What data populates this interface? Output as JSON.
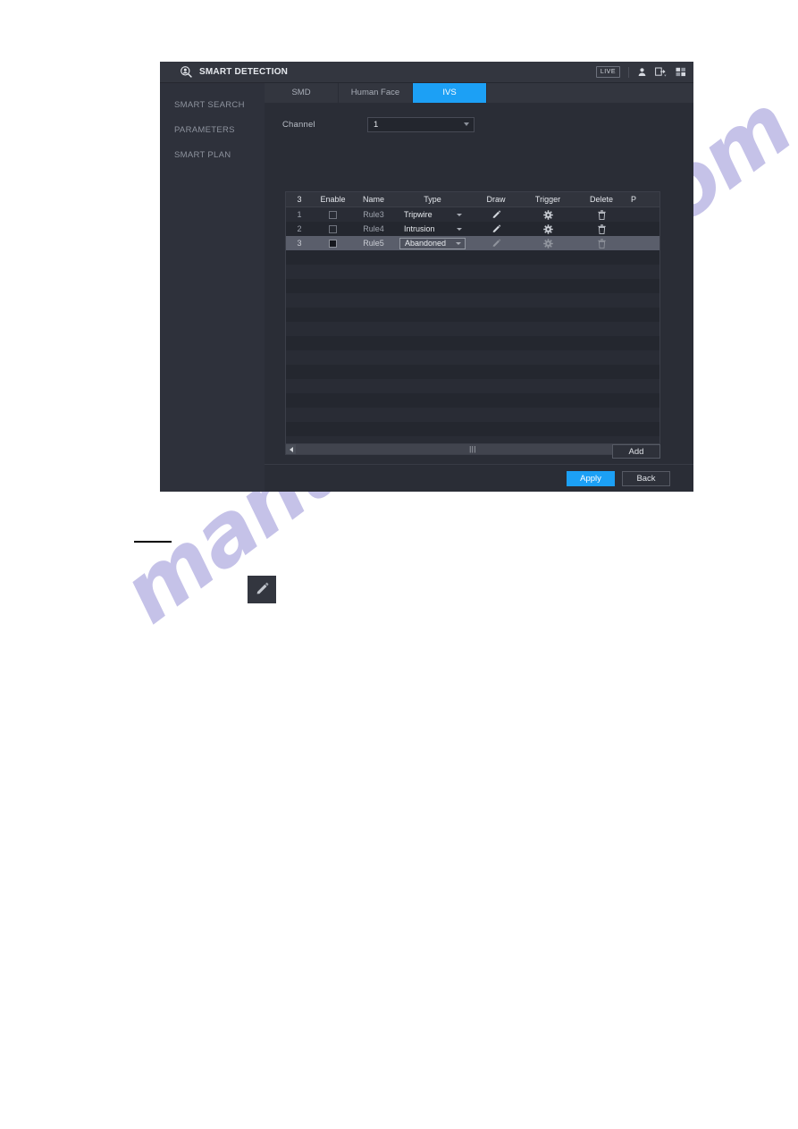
{
  "window": {
    "title": "SMART DETECTION",
    "title_icon": "smart-detection-icon",
    "live_badge": "LIVE",
    "icons": [
      "user-icon",
      "logout-icon",
      "chevron-down-icon",
      "layout-grid-icon"
    ]
  },
  "sidebar": {
    "items": [
      {
        "label": "SMART SEARCH"
      },
      {
        "label": "PARAMETERS"
      },
      {
        "label": "SMART PLAN"
      }
    ]
  },
  "tabs": [
    {
      "label": "SMD",
      "active": false
    },
    {
      "label": "Human Face",
      "active": false
    },
    {
      "label": "IVS",
      "active": true
    }
  ],
  "form": {
    "channel_label": "Channel",
    "channel_value": "1"
  },
  "table": {
    "headers": {
      "index": "3",
      "enable": "Enable",
      "name": "Name",
      "type": "Type",
      "draw": "Draw",
      "trigger": "Trigger",
      "delete": "Delete",
      "partial": "P"
    },
    "rows": [
      {
        "index": "1",
        "enabled": false,
        "name": "Rule3",
        "type": "Tripwire",
        "type_boxed": false,
        "selected": false,
        "draw_icon": "pencil-icon",
        "trigger_icon": "gear-icon",
        "delete_icon": "trash-icon"
      },
      {
        "index": "2",
        "enabled": false,
        "name": "Rule4",
        "type": "Intrusion",
        "type_boxed": false,
        "selected": false,
        "draw_icon": "pencil-icon",
        "trigger_icon": "gear-icon",
        "delete_icon": "trash-icon"
      },
      {
        "index": "3",
        "enabled": true,
        "name": "Rule5",
        "type": "Abandoned",
        "type_boxed": true,
        "selected": true,
        "draw_icon": "pencil-icon",
        "trigger_icon": "gear-icon",
        "delete_icon": "trash-icon"
      }
    ],
    "empty_row_count": 14,
    "scrollbar": {
      "left_arrow": "scroll-left-arrow-icon",
      "right_arrow": "scroll-right-arrow-icon",
      "grip": "|||"
    }
  },
  "buttons": {
    "add": "Add",
    "apply": "Apply",
    "back": "Back"
  },
  "document": {
    "watermark": "manualshive.com",
    "pencil_button_icon": "pencil-icon"
  },
  "colors": {
    "accent": "#1ca0f5",
    "window_bg": "#2a2d36",
    "sidebar_bg": "#2e313b",
    "titlebar_bg": "#33363f",
    "selected_row": "#5a5e6b",
    "watermark": "#3e34b4"
  }
}
